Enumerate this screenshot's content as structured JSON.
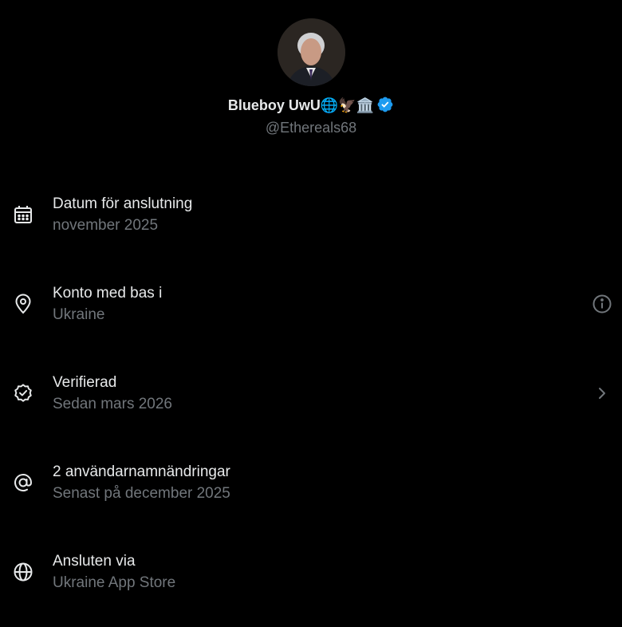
{
  "profile": {
    "display_name": "Blueboy UwU",
    "name_emojis": "🌐🦅🏛️",
    "handle": "@Ethereals68",
    "verified": true
  },
  "rows": [
    {
      "title": "Datum för anslutning",
      "subtitle": "november 2025",
      "icon": "calendar-icon"
    },
    {
      "title": "Konto med bas i",
      "subtitle": "Ukraine",
      "icon": "location-pin-icon",
      "action_icon": "info-icon"
    },
    {
      "title": "Verifierad",
      "subtitle": "Sedan mars 2026",
      "icon": "verified-badge-icon",
      "action_icon": "chevron-right-icon"
    },
    {
      "title": "2 användarnamnändringar",
      "subtitle": "Senast på december 2025",
      "icon": "at-sign-icon"
    },
    {
      "title": "Ansluten via",
      "subtitle": "Ukraine App Store",
      "icon": "globe-icon"
    }
  ],
  "colors": {
    "background": "#000000",
    "primary_text": "#e7e9ea",
    "secondary_text": "#71767b",
    "verified_blue": "#1d9bf0"
  }
}
